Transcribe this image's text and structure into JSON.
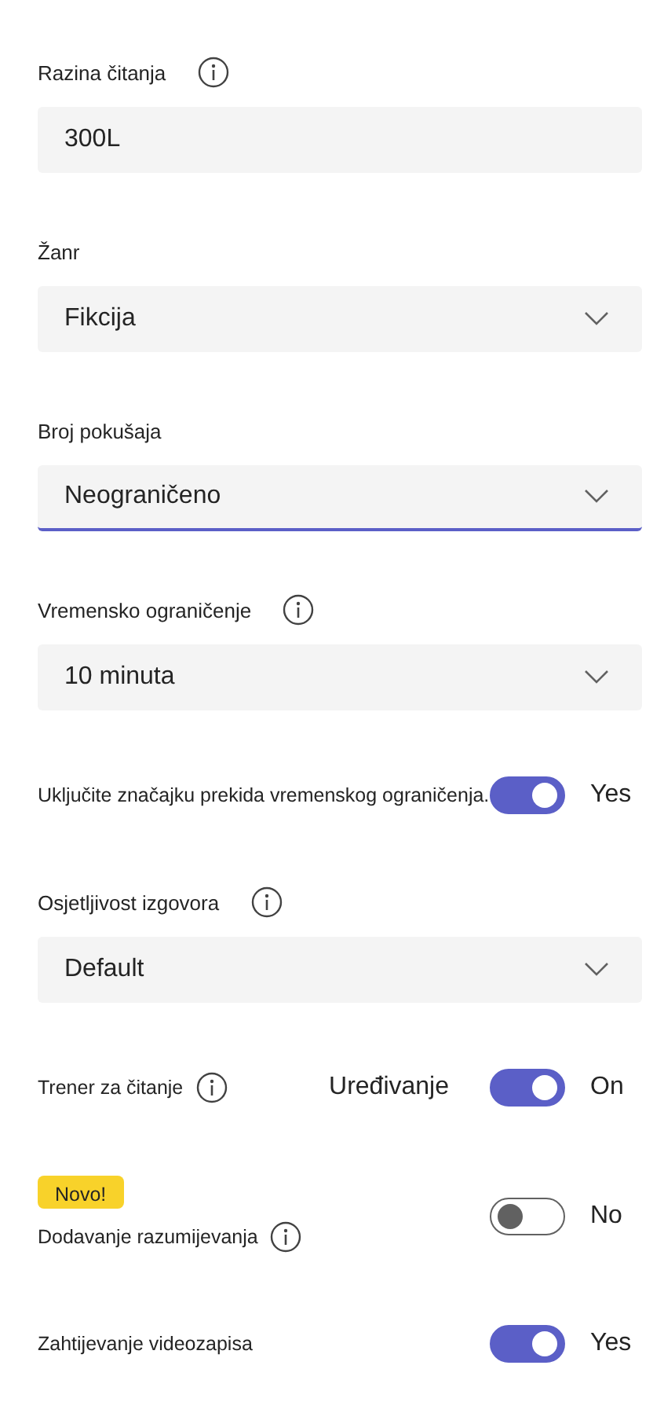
{
  "settings": [
    {
      "kind": "text",
      "label": "Razina čitanja",
      "info": true,
      "value": "300L"
    },
    {
      "kind": "select",
      "label": "Žanr",
      "value": "Fikcija",
      "focused": false
    },
    {
      "kind": "select",
      "label": "Broj pokušaja",
      "value": "Neograničeno",
      "focused": true
    },
    {
      "kind": "select",
      "label": "Vremensko ograničenje",
      "info": true,
      "value": "10 minuta",
      "focused": false
    },
    {
      "kind": "toggle",
      "label": "Uključite značajku prekida vremenskog ograničenja.",
      "on": true,
      "state_text": "Yes"
    },
    {
      "kind": "select",
      "label": "Osjetljivost izgovora",
      "info": true,
      "value": "Default",
      "focused": false
    },
    {
      "kind": "toggle",
      "label": "Trener za čitanje",
      "info": true,
      "link": "Uređivanje",
      "on": true,
      "state_text": "On"
    },
    {
      "kind": "toggle",
      "badge": "Novo!",
      "label": "Dodavanje razumijevanja",
      "info": true,
      "on": false,
      "state_text": "No"
    },
    {
      "kind": "toggle",
      "label": "Zahtijevanje videozapisa",
      "on": true,
      "state_text": "Yes"
    }
  ]
}
